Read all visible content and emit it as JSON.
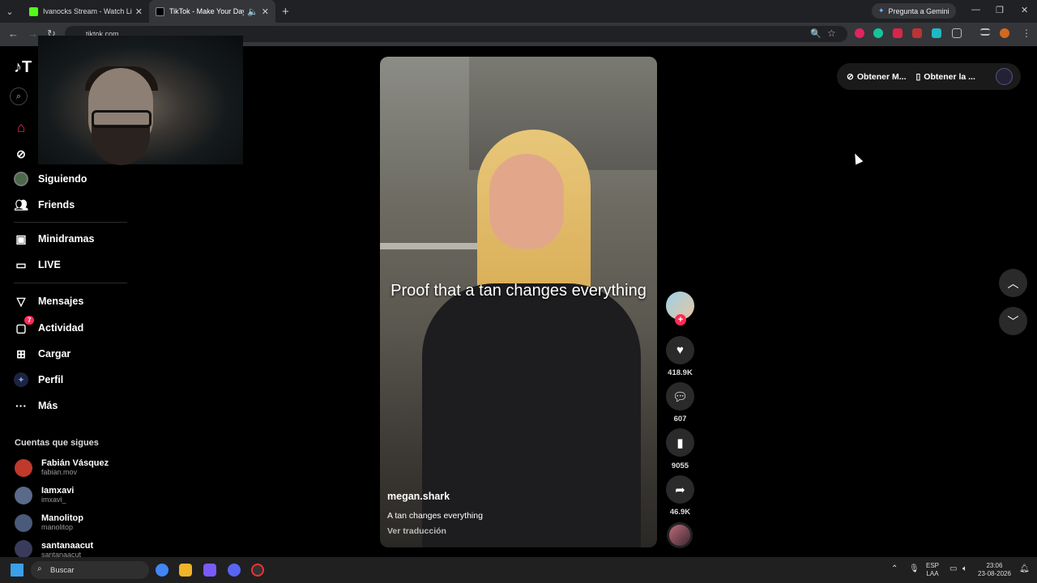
{
  "browser": {
    "tabs": [
      {
        "title": "Ivanocks Stream - Watch Live o",
        "active": false,
        "favicon_color": "#53fc18"
      },
      {
        "title": "TikTok - Make Your Day",
        "active": true,
        "favicon_color": "#ffffff"
      }
    ],
    "gemini_label": "Pregunta a Gemini",
    "url": "tiktok.com"
  },
  "sidebar": {
    "logo": "T",
    "items": [
      {
        "label": "Siguiendo",
        "icon": "following-avatar-icon"
      },
      {
        "label": "Friends",
        "icon": "friends-icon"
      },
      {
        "label": "Minidramas",
        "icon": "minidramas-icon"
      },
      {
        "label": "LIVE",
        "icon": "live-icon"
      },
      {
        "label": "Mensajes",
        "icon": "messages-icon"
      },
      {
        "label": "Actividad",
        "icon": "activity-icon",
        "badge": "7"
      },
      {
        "label": "Cargar",
        "icon": "upload-icon"
      },
      {
        "label": "Perfil",
        "icon": "profile-icon"
      },
      {
        "label": "Más",
        "icon": "more-icon"
      }
    ],
    "following_title": "Cuentas que sigues",
    "accounts": [
      {
        "name": "Fabián Vásquez",
        "handle": "fabian.mov",
        "color": "#c0392b"
      },
      {
        "name": "Iamxavi",
        "handle": "imxavi_",
        "color": "#5a6a8a"
      },
      {
        "name": "Manolitop",
        "handle": "manolitop",
        "color": "#4a5a7a"
      },
      {
        "name": "santanaacut",
        "handle": "santanaacut",
        "color": "#3a3a5a"
      }
    ]
  },
  "video": {
    "caption": "Proof that a tan changes everything",
    "username": "megan.shark",
    "description": "A tan changes everything",
    "translate": "Ver traducción",
    "likes": "418.9K",
    "comments": "607",
    "saves": "9055",
    "shares": "46.9K"
  },
  "topright": {
    "get_coins": "Obtener M...",
    "get_app": "Obtener la ..."
  },
  "taskbar": {
    "search_placeholder": "Buscar",
    "lang1": "ESP",
    "lang2": "LAA",
    "time": "23:06",
    "date": "23-08-2026"
  }
}
